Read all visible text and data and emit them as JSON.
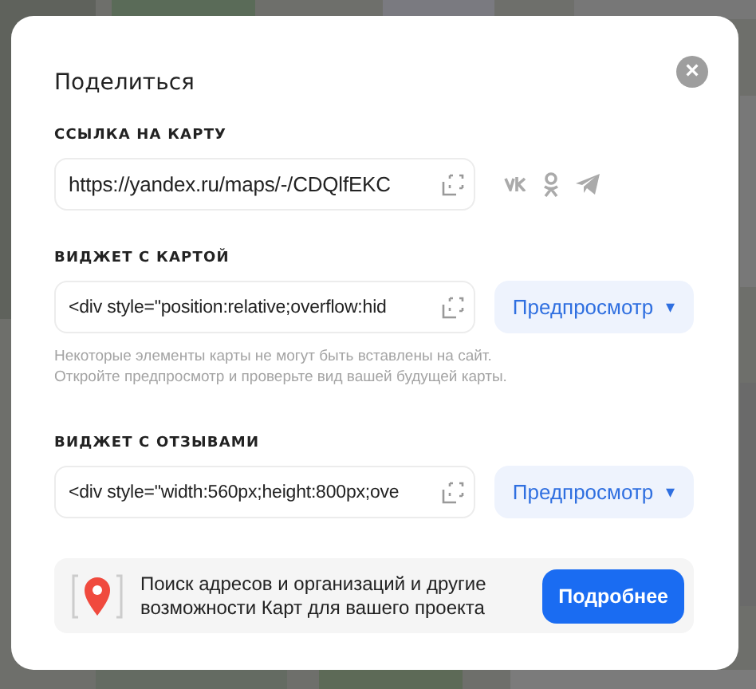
{
  "dialog": {
    "title": "Поделиться",
    "close_label": "×"
  },
  "link_section": {
    "label": "ССЫЛКА НА КАРТУ",
    "value": "https://yandex.ru/maps/-/CDQlfEKC",
    "share_targets": [
      {
        "kind": "vk"
      },
      {
        "kind": "ok"
      },
      {
        "kind": "telegram"
      }
    ]
  },
  "widget_sections": [
    {
      "label": "ВИДЖЕТ С КАРТОЙ",
      "value": "<div style=\"position:relative;overflow:hid",
      "button": "Предпросмотр",
      "caret": "▾",
      "note": "Некоторые элементы карты не могут быть вставлены на сайт.\nОткройте предпросмотр и проверьте вид вашей будущей карты."
    },
    {
      "label": "ВИДЖЕТ С ОТЗЫВАМИ",
      "value": "<div style=\"width:560px;height:800px;ove",
      "button": "Предпросмотр",
      "caret": "▾"
    }
  ],
  "banner": {
    "text": "Поиск адресов и организаций и другие\nвозможности Карт для вашего проекта",
    "button": "Подробнее"
  }
}
